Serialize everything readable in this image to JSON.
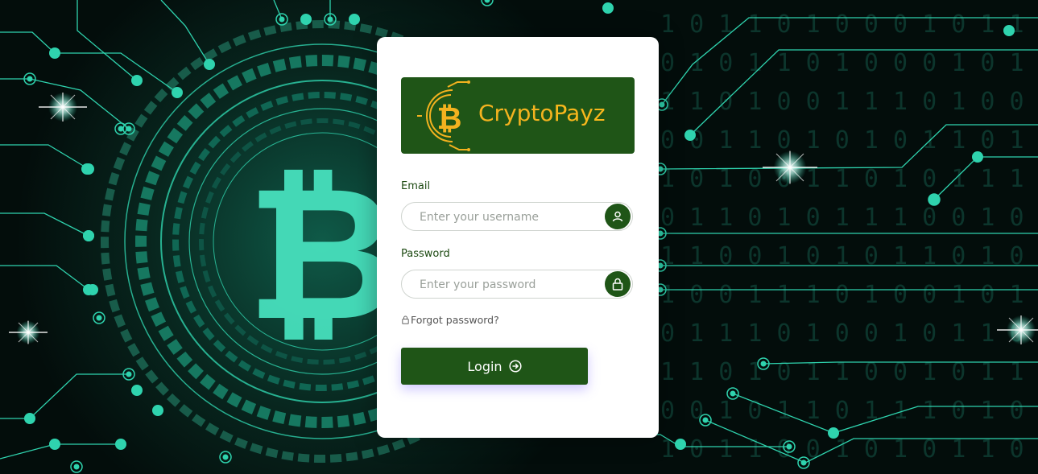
{
  "brand": {
    "name_part1": "Crypto",
    "name_part2": "Payz"
  },
  "form": {
    "email_label": "Email",
    "email_placeholder": "Enter your username",
    "email_icon": "user-icon",
    "password_label": "Password",
    "password_placeholder": "Enter your password",
    "password_icon": "lock-icon",
    "forgot_text": "Forgot password?",
    "login_label": "Login",
    "login_icon": "arrow-circle-right-icon"
  },
  "colors": {
    "brand_green": "#1f5517",
    "brand_gold": "#f3b21f",
    "background_teal": "#2fd3ae",
    "background_dark": "#041310"
  }
}
